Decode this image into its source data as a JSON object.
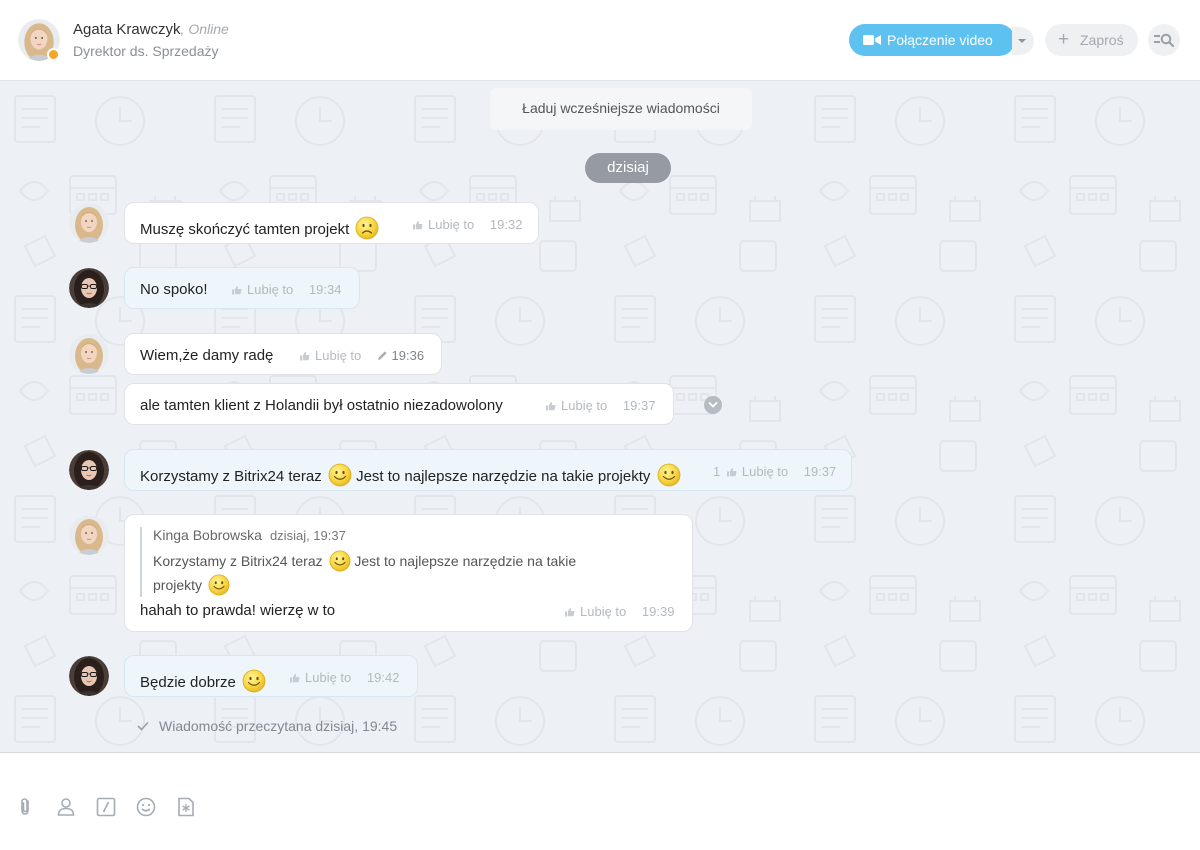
{
  "header": {
    "contact_name": "Agata Krawczyk",
    "contact_status": "Online",
    "contact_role": "Dyrektor ds. Sprzedaży",
    "video_call_label": "Połączenie video",
    "invite_label": "Zaproś"
  },
  "chat": {
    "load_earlier_label": "Ładuj wcześniejsze wiadomości",
    "date_separator": "dzisiaj",
    "like_label": "Lubię to",
    "messages": [
      {
        "author": "Agata Krawczyk",
        "text": "Muszę skończyć tamten projekt",
        "time": "19:32"
      },
      {
        "author": "Kinga Bobrowska",
        "text": "No spoko!",
        "time": "19:34"
      },
      {
        "author": "Agata Krawczyk",
        "text": "Wiem,że damy radę",
        "time": "19:36",
        "edited": true
      },
      {
        "author": "Agata Krawczyk",
        "text": "ale tamten klient z Holandii był ostatnio niezadowolony",
        "time": "19:37"
      },
      {
        "author": "Kinga Bobrowska",
        "text_part1": "Korzystamy z Bitrix24 teraz",
        "text_part2": "Jest to najlepsze narzędzie na takie projekty",
        "likes": "1",
        "time": "19:37"
      },
      {
        "author": "Agata Krawczyk",
        "quote": {
          "author": "Kinga Bobrowska",
          "date": "dzisiaj, 19:37",
          "line1_part1": "Korzystamy z Bitrix24 teraz",
          "line1_part2": "Jest to najlepsze narzędzie na takie",
          "line2": "projekty"
        },
        "text": "hahah to prawda! wierzę w to",
        "time": "19:39"
      },
      {
        "author": "Kinga Bobrowska",
        "text": "Będzie dobrze",
        "time": "19:42"
      }
    ],
    "read_status": "Wiadomość przeczytana dzisiaj, 19:45"
  },
  "footer": {
    "icons": [
      "paperclip-icon",
      "user-icon",
      "command-icon",
      "smiley-icon",
      "snippet-icon"
    ]
  },
  "colors": {
    "accent": "#5ec2f0",
    "status_away": "#f5a623",
    "chat_bg": "#edf0f4",
    "date_pill": "#959aa3"
  }
}
